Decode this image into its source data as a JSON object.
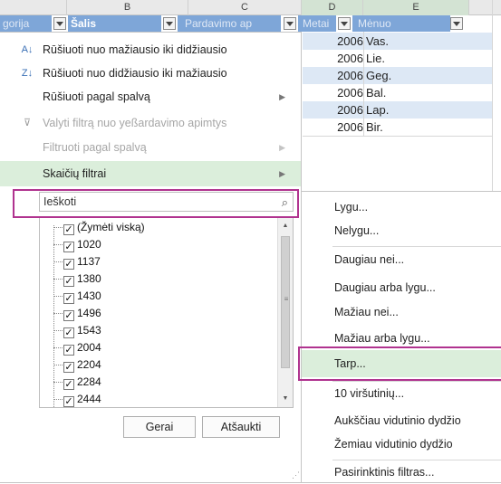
{
  "columns": {
    "a": "",
    "b": "B",
    "c": "C",
    "d": "D",
    "e": "E"
  },
  "header_row": {
    "c1": "gorija",
    "c2": "Šalis",
    "c3": "Pardavimo ap",
    "c4": "Metai",
    "c5": "Mėnuo"
  },
  "data_rows": [
    {
      "year": "2006",
      "month": "Vas."
    },
    {
      "year": "2006",
      "month": "Lie."
    },
    {
      "year": "2006",
      "month": "Geg."
    },
    {
      "year": "2006",
      "month": "Bal."
    },
    {
      "year": "2006",
      "month": "Lap."
    },
    {
      "year": "2006",
      "month": "Bir."
    }
  ],
  "menu": {
    "sort_asc": "Rūšiuoti nuo mažiausio iki didžiausio",
    "sort_desc": "Rūšiuoti nuo didžiausio iki mažiausio",
    "sort_color": "Rūšiuoti pagal spalvą",
    "clear_filter": "Valyti filtrą nuo yeßardavimo apimtys",
    "filter_color": "Filtruoti pagal spalvą",
    "number_filters": "Skaičių filtrai",
    "search_placeholder": "Ieškoti",
    "list": [
      "(Žymėti viską)",
      "1020",
      "1137",
      "1380",
      "1430",
      "1496",
      "1543",
      "2004",
      "2204",
      "2284",
      "2444"
    ],
    "ok": "Gerai",
    "cancel": "Atšaukti"
  },
  "submenu": {
    "equals": "Lygu...",
    "not_equals": "Nelygu...",
    "greater": "Daugiau nei...",
    "greater_equal": "Daugiau arba lygu...",
    "less": "Mažiau nei...",
    "less_equal": "Mažiau arba lygu...",
    "between": "Tarp...",
    "top10": "10 viršutinių...",
    "above_avg": "Aukščiau vidutinio dydžio",
    "below_avg": "Žemiau vidutinio dydžio",
    "custom": "Pasirinktinis filtras..."
  },
  "colors": {
    "header_blue": "#7ea6d8",
    "band": "#dde8f5",
    "highlight": "#dbeedb",
    "callout": "#b0338f"
  }
}
